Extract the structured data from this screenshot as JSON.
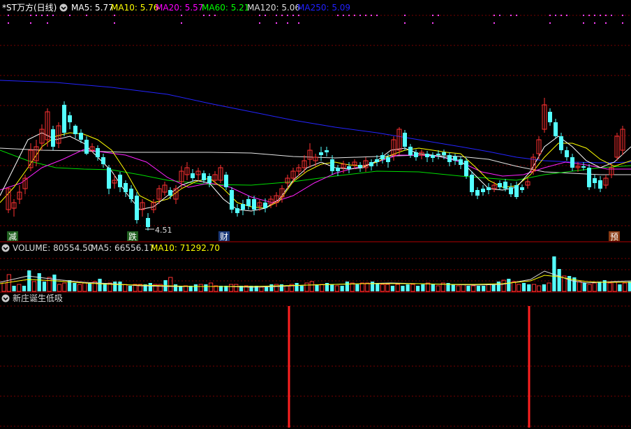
{
  "header": {
    "title": "*ST万方(日线)",
    "ma_items": [
      {
        "label": "MA5: 5.77",
        "color": "#ffffff"
      },
      {
        "label": "MA10: 5.76",
        "color": "#ffff00"
      },
      {
        "label": "MA20: 5.57",
        "color": "#ff00ff"
      },
      {
        "label": "MA60: 5.21",
        "color": "#00ff00"
      },
      {
        "label": "MA120: 5.06",
        "color": "#dcdcdc"
      },
      {
        "label": "MA250: 5.09",
        "color": "#2020ff"
      }
    ]
  },
  "markers": {
    "low_price": "4.51",
    "events": [
      {
        "text": "减",
        "bg": "#1f5f1f",
        "fg": "#ffffff"
      },
      {
        "text": "跌",
        "bg": "#1f5f1f",
        "fg": "#ffffff"
      },
      {
        "text": "财",
        "bg": "#1c3a7a",
        "fg": "#ffffff"
      },
      {
        "text": "预",
        "bg": "#8a3a12",
        "fg": "#ffffff"
      }
    ]
  },
  "volume_header": {
    "items": [
      {
        "label": "VOLUME: 80554.50",
        "color": "#dcdcdc"
      },
      {
        "label": "MA5: 66556.17",
        "color": "#dcdcdc"
      },
      {
        "label": "MA10: 71292.70",
        "color": "#ffff00"
      }
    ]
  },
  "indicator_header": {
    "title": "新庄诞生低吸"
  },
  "colors": {
    "up": "#ff3232",
    "down": "#54ffff",
    "grid": "#7a0000",
    "signal": "#ff2020"
  }
}
